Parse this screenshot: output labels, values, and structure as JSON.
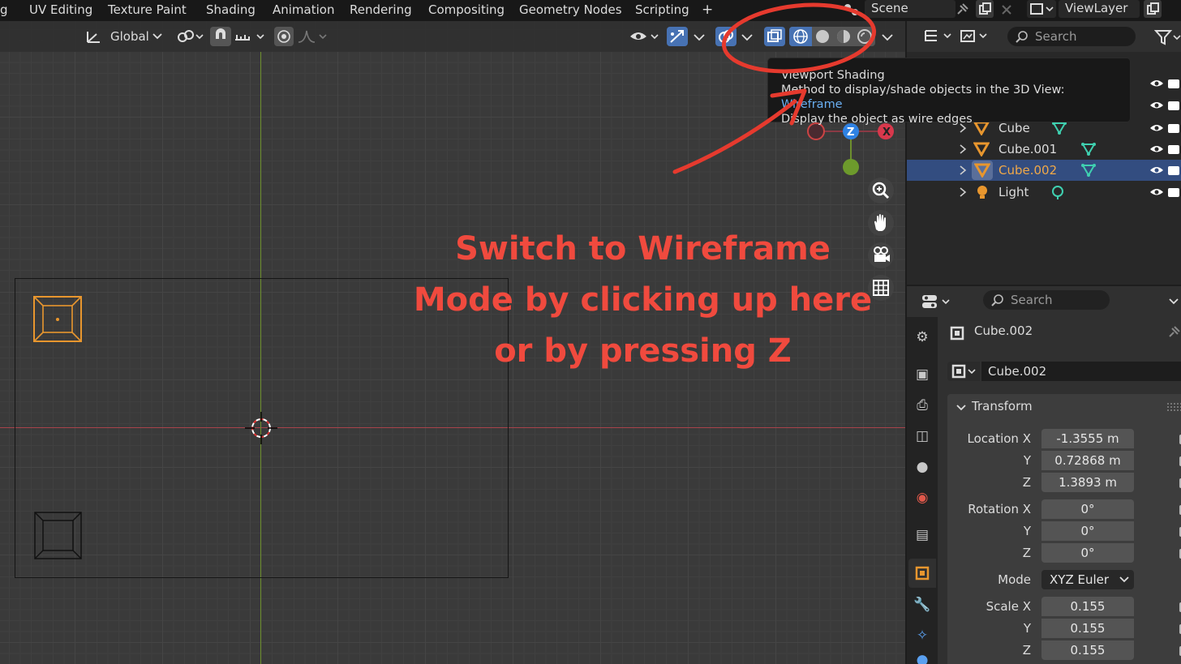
{
  "workspace_tabs": [
    "g",
    "UV Editing",
    "Texture Paint",
    "Shading",
    "Animation",
    "Rendering",
    "Compositing",
    "Geometry Nodes",
    "Scripting"
  ],
  "add_tab": "+",
  "scene": "Scene",
  "view_layer": "ViewLayer",
  "viewport": {
    "orientation": "Global",
    "gizmo_labels": {
      "x": "X",
      "z": "Z"
    }
  },
  "tooltip": {
    "title": "Viewport Shading",
    "line2_prefix": "Method to display/shade objects in the 3D View: ",
    "line2_value": "Wireframe",
    "line3": "Display the object as wire edges"
  },
  "annotation": {
    "line1": "Switch to Wireframe",
    "line2": "Mode  by clicking up here",
    "line3": "or by pressing Z",
    "color": "#f04a3e"
  },
  "outliner": {
    "search_placeholder": "Search",
    "items": [
      {
        "name": "Cube",
        "selected": false
      },
      {
        "name": "Cube.001",
        "selected": false
      },
      {
        "name": "Cube.002",
        "selected": true
      },
      {
        "name": "Light",
        "selected": false
      }
    ]
  },
  "properties": {
    "search_placeholder": "Search",
    "object_name": "Cube.002",
    "data_name": "Cube.002",
    "panel_title": "Transform",
    "location": {
      "label": "Location X",
      "x": "-1.3555 m",
      "y": "0.72868 m",
      "z": "1.3893 m"
    },
    "rotation": {
      "label": "Rotation X",
      "x": "0°",
      "y": "0°",
      "z": "0°"
    },
    "mode": {
      "label": "Mode",
      "value": "XYZ Euler"
    },
    "scale": {
      "label": "Scale X",
      "x": "0.155",
      "y": "0.155",
      "z": "0.155"
    },
    "axis_y": "Y",
    "axis_z": "Z"
  },
  "colors": {
    "accent_blue": "#4772b3",
    "selection": "#334d80",
    "object_orange": "#e8962e",
    "annotation_red": "#f04a3e"
  }
}
